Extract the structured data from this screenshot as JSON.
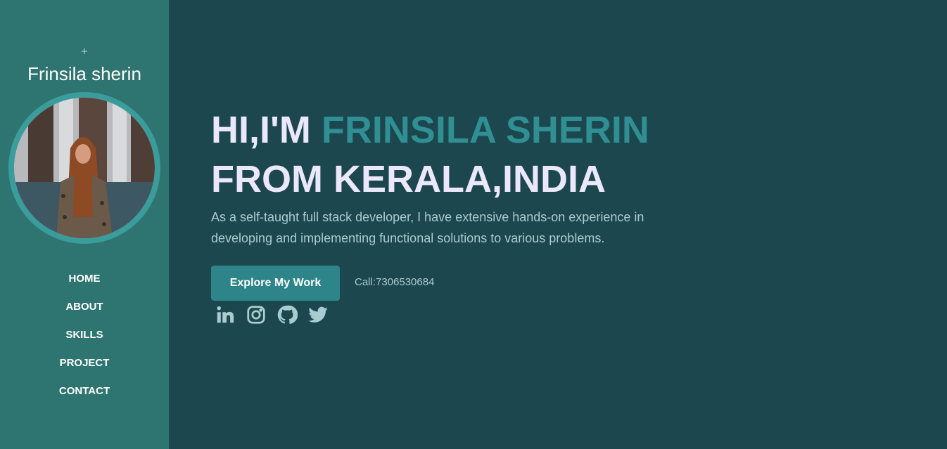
{
  "sidebar": {
    "plus": "+",
    "name": "Frinsila sherin",
    "nav": [
      "HOME",
      "ABOUT",
      "SKILLS",
      "PROJECT",
      "CONTACT"
    ]
  },
  "hero": {
    "greeting": "HI,I'M ",
    "highlight_name": "FRINSILA SHERIN",
    "line2": "FROM KERALA,INDIA",
    "description": "As a self-taught full stack developer, I have extensive hands-on experience in developing and implementing functional solutions to various problems.",
    "cta_label": "Explore My Work",
    "call": "Call:7306530684"
  },
  "socials": [
    "linkedin-icon",
    "instagram-icon",
    "github-icon",
    "twitter-icon"
  ],
  "colors": {
    "sidebar_bg": "#2e7470",
    "main_bg": "#1c474e",
    "accent": "#2f8f92",
    "headline": "#ece8fb",
    "body_text": "#a9ccd0",
    "icon": "#a9ccd0"
  }
}
